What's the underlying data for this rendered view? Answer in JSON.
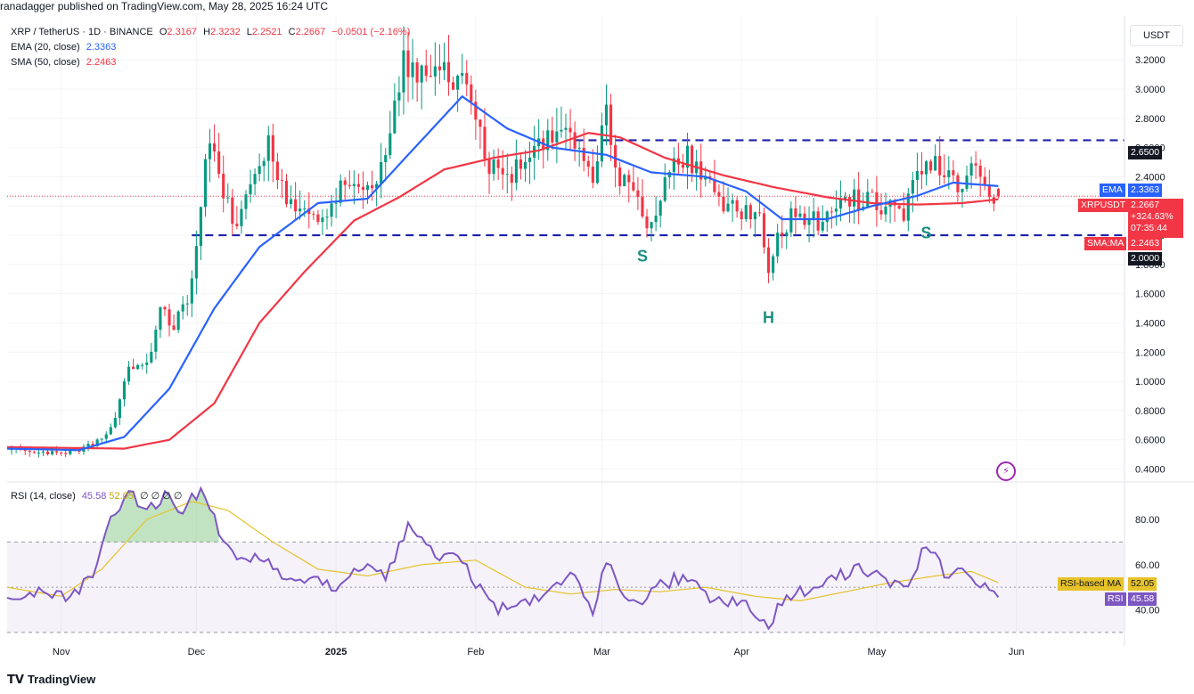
{
  "header": {
    "publisher": "ranadagger published on TradingView.com, May 28, 2025 16:24 UTC",
    "symbol_line": "XRP / TetherUS · 1D · BINANCE",
    "ohlc": {
      "o_label": "O",
      "o": "2.3167",
      "h_label": "H",
      "h": "2.3232",
      "l_label": "L",
      "l": "2.2521",
      "c_label": "C",
      "c": "2.2667",
      "change": "−0.0501 (−2.16%)"
    },
    "ema_label": "EMA (20, close)",
    "ema_value": "2.3363",
    "sma_label": "SMA (50, close)",
    "sma_value": "2.2463",
    "currency_button": "USDT"
  },
  "rsi_legend": {
    "label": "RSI (14, close)",
    "rsi": "45.58",
    "rsi_ma": "52.05",
    "extra": "∅ ∅ ∅ ∅"
  },
  "price_tags": {
    "level_high": "2.6500",
    "ema_name": "EMA",
    "ema_value": "2.3363",
    "symbol": "XRPUSDT",
    "price": "2.2667",
    "change_pct": "+324.63%",
    "countdown": "07:35:44",
    "sma_name": "SMA:MA",
    "sma_value": "2.2463",
    "level_low": "2.0000"
  },
  "rsi_tags": {
    "ma_name": "RSI-based MA",
    "ma_value": "52.05",
    "rsi_name": "RSI",
    "rsi_value": "45.58"
  },
  "annotations": [
    {
      "text": "S",
      "date": "2025-03-10",
      "price": 1.82
    },
    {
      "text": "H",
      "date": "2025-04-07",
      "price": 1.4
    },
    {
      "text": "S",
      "date": "2025-05-12",
      "price": 1.98
    }
  ],
  "footer": {
    "brand": "TradingView"
  },
  "colors": {
    "up": "#089981",
    "down": "#f23645",
    "ema": "#2962ff",
    "sma": "#f23645",
    "rsi": "#7e57c2",
    "rsi_ma": "#e6c229",
    "level": "#1e22aa",
    "annotation": "#1a8f80"
  },
  "chart_data": {
    "type": "candlestick",
    "symbol": "XRP / TetherUS",
    "interval": "1D",
    "price_axis": {
      "ticks": [
        "0.4000",
        "0.6000",
        "0.8000",
        "1.0000",
        "1.2000",
        "1.4000",
        "1.6000",
        "1.8000",
        "2.0000",
        "2.2000",
        "2.4000",
        "2.6000",
        "2.8000",
        "3.0000",
        "3.2000"
      ],
      "ylim": [
        0.33,
        3.5
      ]
    },
    "time_axis": {
      "labels": [
        "Nov",
        "Dec",
        "2025",
        "Feb",
        "Mar",
        "Apr",
        "May",
        "Jun"
      ],
      "label_dates": [
        "2024-11-01",
        "2024-12-01",
        "2025-01-01",
        "2025-02-01",
        "2025-03-01",
        "2025-04-01",
        "2025-05-01",
        "2025-06-01"
      ],
      "range": [
        "2024-10-20",
        "2025-06-25"
      ]
    },
    "horizontal_levels": [
      2.65,
      2.0
    ],
    "series": [
      {
        "name": "Price",
        "kind": "candles",
        "anchors": [
          [
            "2024-10-20",
            0.53
          ],
          [
            "2024-11-04",
            0.51
          ],
          [
            "2024-11-10",
            0.6
          ],
          [
            "2024-11-13",
            0.75
          ],
          [
            "2024-11-16",
            1.12
          ],
          [
            "2024-11-20",
            1.1
          ],
          [
            "2024-11-23",
            1.5
          ],
          [
            "2024-11-26",
            1.38
          ],
          [
            "2024-11-29",
            1.55
          ],
          [
            "2024-12-02",
            2.2
          ],
          [
            "2024-12-04",
            2.7
          ],
          [
            "2024-12-07",
            2.25
          ],
          [
            "2024-12-10",
            2.1
          ],
          [
            "2024-12-14",
            2.35
          ],
          [
            "2024-12-17",
            2.6
          ],
          [
            "2024-12-21",
            2.25
          ],
          [
            "2024-12-25",
            2.18
          ],
          [
            "2024-12-30",
            2.07
          ],
          [
            "2025-01-03",
            2.4
          ],
          [
            "2025-01-08",
            2.3
          ],
          [
            "2025-01-12",
            2.52
          ],
          [
            "2025-01-16",
            3.22
          ],
          [
            "2025-01-18",
            3.1
          ],
          [
            "2025-01-21",
            3.05
          ],
          [
            "2025-01-26",
            3.12
          ],
          [
            "2025-01-29",
            3.05
          ],
          [
            "2025-02-02",
            2.65
          ],
          [
            "2025-02-04",
            2.5
          ],
          [
            "2025-02-08",
            2.42
          ],
          [
            "2025-02-14",
            2.55
          ],
          [
            "2025-02-19",
            2.7
          ],
          [
            "2025-02-24",
            2.6
          ],
          [
            "2025-02-27",
            2.28
          ],
          [
            "2025-03-02",
            2.9
          ],
          [
            "2025-03-04",
            2.4
          ],
          [
            "2025-03-08",
            2.3
          ],
          [
            "2025-03-11",
            2.05
          ],
          [
            "2025-03-15",
            2.35
          ],
          [
            "2025-03-19",
            2.55
          ],
          [
            "2025-03-23",
            2.45
          ],
          [
            "2025-03-27",
            2.25
          ],
          [
            "2025-04-01",
            2.15
          ],
          [
            "2025-04-05",
            2.1
          ],
          [
            "2025-04-07",
            1.78
          ],
          [
            "2025-04-09",
            2.02
          ],
          [
            "2025-04-13",
            2.15
          ],
          [
            "2025-04-18",
            2.08
          ],
          [
            "2025-04-22",
            2.2
          ],
          [
            "2025-04-26",
            2.25
          ],
          [
            "2025-04-30",
            2.22
          ],
          [
            "2025-05-04",
            2.18
          ],
          [
            "2025-05-07",
            2.15
          ],
          [
            "2025-05-10",
            2.4
          ],
          [
            "2025-05-12",
            2.58
          ],
          [
            "2025-05-14",
            2.48
          ],
          [
            "2025-05-18",
            2.35
          ],
          [
            "2025-05-22",
            2.42
          ],
          [
            "2025-05-26",
            2.32
          ],
          [
            "2025-05-28",
            2.2667
          ]
        ]
      },
      {
        "name": "EMA (20, close)",
        "kind": "line",
        "anchors": [
          [
            "2024-10-20",
            0.54
          ],
          [
            "2024-11-05",
            0.53
          ],
          [
            "2024-11-15",
            0.62
          ],
          [
            "2024-11-25",
            0.95
          ],
          [
            "2024-12-05",
            1.5
          ],
          [
            "2024-12-15",
            1.92
          ],
          [
            "2024-12-28",
            2.22
          ],
          [
            "2025-01-08",
            2.25
          ],
          [
            "2025-01-20",
            2.65
          ],
          [
            "2025-01-29",
            2.95
          ],
          [
            "2025-02-08",
            2.73
          ],
          [
            "2025-02-18",
            2.6
          ],
          [
            "2025-03-02",
            2.55
          ],
          [
            "2025-03-12",
            2.43
          ],
          [
            "2025-03-24",
            2.4
          ],
          [
            "2025-04-02",
            2.3
          ],
          [
            "2025-04-10",
            2.11
          ],
          [
            "2025-04-20",
            2.11
          ],
          [
            "2025-04-30",
            2.2
          ],
          [
            "2025-05-10",
            2.27
          ],
          [
            "2025-05-18",
            2.36
          ],
          [
            "2025-05-28",
            2.3363
          ]
        ]
      },
      {
        "name": "SMA (50, close)",
        "kind": "line",
        "anchors": [
          [
            "2024-10-20",
            0.55
          ],
          [
            "2024-11-15",
            0.54
          ],
          [
            "2024-11-25",
            0.6
          ],
          [
            "2024-12-05",
            0.85
          ],
          [
            "2024-12-15",
            1.4
          ],
          [
            "2024-12-25",
            1.75
          ],
          [
            "2025-01-05",
            2.1
          ],
          [
            "2025-01-15",
            2.26
          ],
          [
            "2025-01-25",
            2.45
          ],
          [
            "2025-02-05",
            2.53
          ],
          [
            "2025-02-15",
            2.58
          ],
          [
            "2025-02-26",
            2.7
          ],
          [
            "2025-03-05",
            2.67
          ],
          [
            "2025-03-15",
            2.53
          ],
          [
            "2025-03-28",
            2.41
          ],
          [
            "2025-04-08",
            2.33
          ],
          [
            "2025-04-20",
            2.26
          ],
          [
            "2025-04-30",
            2.22
          ],
          [
            "2025-05-10",
            2.21
          ],
          [
            "2025-05-20",
            2.22
          ],
          [
            "2025-05-28",
            2.2463
          ]
        ]
      }
    ],
    "rsi": {
      "label": "RSI (14, close)",
      "ticks": [
        "40.00",
        "60.00",
        "80.00"
      ],
      "ylim": [
        28,
        95
      ],
      "bands": [
        70,
        50,
        30
      ],
      "series": [
        {
          "name": "RSI",
          "anchors": [
            [
              "2024-10-20",
              44
            ],
            [
              "2024-10-27",
              49
            ],
            [
              "2024-11-03",
              44
            ],
            [
              "2024-11-08",
              56
            ],
            [
              "2024-11-12",
              81
            ],
            [
              "2024-11-16",
              92
            ],
            [
              "2024-11-20",
              84
            ],
            [
              "2024-11-24",
              90
            ],
            [
              "2024-11-28",
              85
            ],
            [
              "2024-12-02",
              93
            ],
            [
              "2024-12-05",
              80
            ],
            [
              "2024-12-10",
              60
            ],
            [
              "2024-12-16",
              63
            ],
            [
              "2024-12-21",
              54
            ],
            [
              "2024-12-28",
              52
            ],
            [
              "2025-01-01",
              50
            ],
            [
              "2025-01-07",
              60
            ],
            [
              "2025-01-12",
              55
            ],
            [
              "2025-01-17",
              76
            ],
            [
              "2025-01-22",
              66
            ],
            [
              "2025-01-28",
              62
            ],
            [
              "2025-02-02",
              50
            ],
            [
              "2025-02-06",
              41
            ],
            [
              "2025-02-12",
              42
            ],
            [
              "2025-02-18",
              48
            ],
            [
              "2025-02-22",
              56
            ],
            [
              "2025-02-27",
              38
            ],
            [
              "2025-03-02",
              62
            ],
            [
              "2025-03-06",
              44
            ],
            [
              "2025-03-10",
              45
            ],
            [
              "2025-03-15",
              52
            ],
            [
              "2025-03-20",
              55
            ],
            [
              "2025-03-26",
              44
            ],
            [
              "2025-04-02",
              42
            ],
            [
              "2025-04-07",
              34
            ],
            [
              "2025-04-11",
              46
            ],
            [
              "2025-04-17",
              49
            ],
            [
              "2025-04-22",
              55
            ],
            [
              "2025-04-28",
              58
            ],
            [
              "2025-05-03",
              53
            ],
            [
              "2025-05-07",
              49
            ],
            [
              "2025-05-12",
              69
            ],
            [
              "2025-05-16",
              57
            ],
            [
              "2025-05-21",
              55
            ],
            [
              "2025-05-25",
              52
            ],
            [
              "2025-05-28",
              45.58
            ]
          ]
        },
        {
          "name": "RSI-based MA",
          "anchors": [
            [
              "2024-10-20",
              50
            ],
            [
              "2024-11-01",
              46
            ],
            [
              "2024-11-10",
              58
            ],
            [
              "2024-11-20",
              80
            ],
            [
              "2024-11-30",
              88
            ],
            [
              "2024-12-08",
              84
            ],
            [
              "2024-12-18",
              70
            ],
            [
              "2024-12-28",
              58
            ],
            [
              "2025-01-08",
              55
            ],
            [
              "2025-01-20",
              60
            ],
            [
              "2025-02-01",
              62
            ],
            [
              "2025-02-12",
              50
            ],
            [
              "2025-02-22",
              47
            ],
            [
              "2025-03-04",
              49
            ],
            [
              "2025-03-14",
              48
            ],
            [
              "2025-03-24",
              50
            ],
            [
              "2025-04-04",
              46
            ],
            [
              "2025-04-14",
              44
            ],
            [
              "2025-04-24",
              48
            ],
            [
              "2025-05-04",
              52
            ],
            [
              "2025-05-14",
              55
            ],
            [
              "2025-05-22",
              57
            ],
            [
              "2025-05-28",
              52.05
            ]
          ]
        }
      ]
    }
  }
}
